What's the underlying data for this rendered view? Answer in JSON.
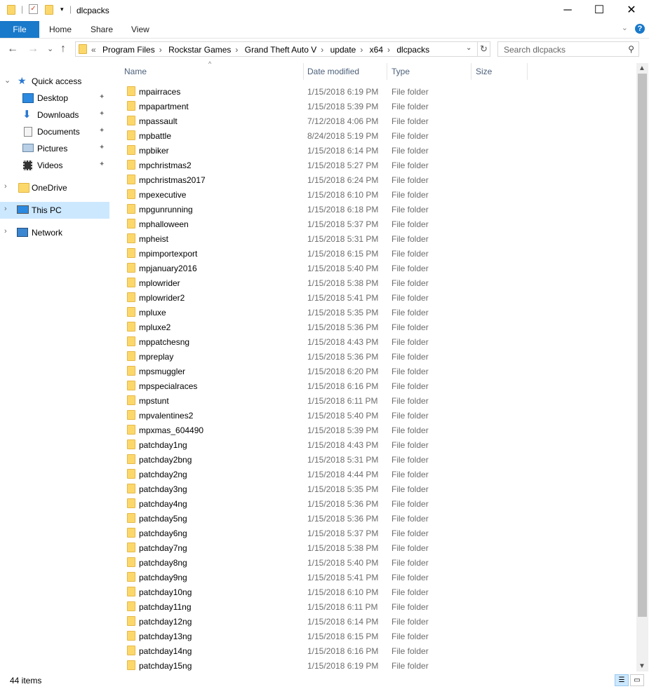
{
  "window": {
    "title": "dlcpacks",
    "minimize": "─",
    "maximize": "☐",
    "close": "✕"
  },
  "ribbon": {
    "file": "File",
    "home": "Home",
    "share": "Share",
    "view": "View",
    "help": "?",
    "collapse": "⌄"
  },
  "nav": {
    "back": "←",
    "forward": "→",
    "recent": "⌄",
    "up": "↑"
  },
  "address": {
    "overflow": "«",
    "crumbs": [
      "Program Files",
      "Rockstar Games",
      "Grand Theft Auto V",
      "update",
      "x64",
      "dlcpacks"
    ],
    "separator": "›",
    "dropdown": "⌄",
    "refresh": "↻"
  },
  "search": {
    "placeholder": "Search dlcpacks",
    "icon": "⚲"
  },
  "sidebar": {
    "items": [
      {
        "label": "Quick access",
        "icon": "star-icon"
      },
      {
        "label": "Desktop",
        "icon": "desktop-icon",
        "pinned": true
      },
      {
        "label": "Downloads",
        "icon": "download-icon",
        "pinned": true
      },
      {
        "label": "Documents",
        "icon": "documents-icon",
        "pinned": true
      },
      {
        "label": "Pictures",
        "icon": "pictures-icon",
        "pinned": true
      },
      {
        "label": "Videos",
        "icon": "videos-icon",
        "pinned": true
      },
      {
        "label": "OneDrive",
        "icon": "folder-icon"
      },
      {
        "label": "This PC",
        "icon": "computer-icon"
      },
      {
        "label": "Network",
        "icon": "network-icon"
      }
    ],
    "pin_glyph": "📌",
    "expand_glyph": "›",
    "expanded_glyph": "⌄"
  },
  "columns": {
    "name": "Name",
    "date": "Date modified",
    "type": "Type",
    "size": "Size",
    "sort_glyph": "^"
  },
  "files": [
    {
      "name": "mpairraces",
      "date": "1/15/2018 6:19 PM",
      "type": "File folder"
    },
    {
      "name": "mpapartment",
      "date": "1/15/2018 5:39 PM",
      "type": "File folder"
    },
    {
      "name": "mpassault",
      "date": "7/12/2018 4:06 PM",
      "type": "File folder"
    },
    {
      "name": "mpbattle",
      "date": "8/24/2018 5:19 PM",
      "type": "File folder"
    },
    {
      "name": "mpbiker",
      "date": "1/15/2018 6:14 PM",
      "type": "File folder"
    },
    {
      "name": "mpchristmas2",
      "date": "1/15/2018 5:27 PM",
      "type": "File folder"
    },
    {
      "name": "mpchristmas2017",
      "date": "1/15/2018 6:24 PM",
      "type": "File folder"
    },
    {
      "name": "mpexecutive",
      "date": "1/15/2018 6:10 PM",
      "type": "File folder"
    },
    {
      "name": "mpgunrunning",
      "date": "1/15/2018 6:18 PM",
      "type": "File folder"
    },
    {
      "name": "mphalloween",
      "date": "1/15/2018 5:37 PM",
      "type": "File folder"
    },
    {
      "name": "mpheist",
      "date": "1/15/2018 5:31 PM",
      "type": "File folder"
    },
    {
      "name": "mpimportexport",
      "date": "1/15/2018 6:15 PM",
      "type": "File folder"
    },
    {
      "name": "mpjanuary2016",
      "date": "1/15/2018 5:40 PM",
      "type": "File folder"
    },
    {
      "name": "mplowrider",
      "date": "1/15/2018 5:38 PM",
      "type": "File folder"
    },
    {
      "name": "mplowrider2",
      "date": "1/15/2018 5:41 PM",
      "type": "File folder"
    },
    {
      "name": "mpluxe",
      "date": "1/15/2018 5:35 PM",
      "type": "File folder"
    },
    {
      "name": "mpluxe2",
      "date": "1/15/2018 5:36 PM",
      "type": "File folder"
    },
    {
      "name": "mppatchesng",
      "date": "1/15/2018 4:43 PM",
      "type": "File folder"
    },
    {
      "name": "mpreplay",
      "date": "1/15/2018 5:36 PM",
      "type": "File folder"
    },
    {
      "name": "mpsmuggler",
      "date": "1/15/2018 6:20 PM",
      "type": "File folder"
    },
    {
      "name": "mpspecialraces",
      "date": "1/15/2018 6:16 PM",
      "type": "File folder"
    },
    {
      "name": "mpstunt",
      "date": "1/15/2018 6:11 PM",
      "type": "File folder"
    },
    {
      "name": "mpvalentines2",
      "date": "1/15/2018 5:40 PM",
      "type": "File folder"
    },
    {
      "name": "mpxmas_604490",
      "date": "1/15/2018 5:39 PM",
      "type": "File folder"
    },
    {
      "name": "patchday1ng",
      "date": "1/15/2018 4:43 PM",
      "type": "File folder"
    },
    {
      "name": "patchday2bng",
      "date": "1/15/2018 5:31 PM",
      "type": "File folder"
    },
    {
      "name": "patchday2ng",
      "date": "1/15/2018 4:44 PM",
      "type": "File folder"
    },
    {
      "name": "patchday3ng",
      "date": "1/15/2018 5:35 PM",
      "type": "File folder"
    },
    {
      "name": "patchday4ng",
      "date": "1/15/2018 5:36 PM",
      "type": "File folder"
    },
    {
      "name": "patchday5ng",
      "date": "1/15/2018 5:36 PM",
      "type": "File folder"
    },
    {
      "name": "patchday6ng",
      "date": "1/15/2018 5:37 PM",
      "type": "File folder"
    },
    {
      "name": "patchday7ng",
      "date": "1/15/2018 5:38 PM",
      "type": "File folder"
    },
    {
      "name": "patchday8ng",
      "date": "1/15/2018 5:40 PM",
      "type": "File folder"
    },
    {
      "name": "patchday9ng",
      "date": "1/15/2018 5:41 PM",
      "type": "File folder"
    },
    {
      "name": "patchday10ng",
      "date": "1/15/2018 6:10 PM",
      "type": "File folder"
    },
    {
      "name": "patchday11ng",
      "date": "1/15/2018 6:11 PM",
      "type": "File folder"
    },
    {
      "name": "patchday12ng",
      "date": "1/15/2018 6:14 PM",
      "type": "File folder"
    },
    {
      "name": "patchday13ng",
      "date": "1/15/2018 6:15 PM",
      "type": "File folder"
    },
    {
      "name": "patchday14ng",
      "date": "1/15/2018 6:16 PM",
      "type": "File folder"
    },
    {
      "name": "patchday15ng",
      "date": "1/15/2018 6:19 PM",
      "type": "File folder"
    }
  ],
  "status": {
    "count": "44 items"
  },
  "colors": {
    "accent": "#1979ca",
    "selected": "#cce8ff",
    "folder": "#fcd86b",
    "header_text": "#4c607a"
  }
}
